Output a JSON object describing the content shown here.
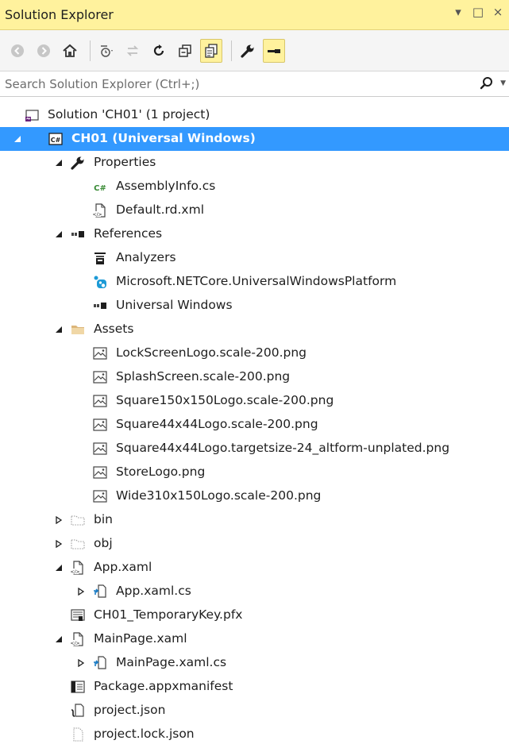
{
  "window": {
    "title": "Solution Explorer",
    "controls": [
      "▾",
      "□",
      "×"
    ]
  },
  "toolbar": {
    "buttons": [
      {
        "name": "back-button",
        "icon": "back-arrow-icon"
      },
      {
        "name": "forward-button",
        "icon": "forward-arrow-icon"
      },
      {
        "name": "home-button",
        "icon": "home-icon"
      },
      {
        "name": "pending-changes-filter-button",
        "icon": "clock-filter-icon"
      },
      {
        "name": "sync-with-active-document-button",
        "icon": "sync-icon"
      },
      {
        "name": "refresh-button",
        "icon": "refresh-icon"
      },
      {
        "name": "collapse-all-button",
        "icon": "collapse-all-icon"
      },
      {
        "name": "show-all-files-button",
        "icon": "show-all-files-icon"
      },
      {
        "name": "properties-button",
        "icon": "wrench-icon"
      },
      {
        "name": "preview-selected-items-button",
        "icon": "preview-icon"
      }
    ]
  },
  "search": {
    "placeholder": "Search Solution Explorer (Ctrl+;)"
  },
  "tree": [
    {
      "label": "Solution 'CH01' (1 project)",
      "icon": "solution-icon",
      "level": 0,
      "expander": "none"
    },
    {
      "label": "CH01 (Universal Windows)",
      "icon": "csharp-project-icon",
      "level": 0,
      "expander": "expanded",
      "selected": true
    },
    {
      "label": "Properties",
      "icon": "wrench-icon",
      "level": 1,
      "expander": "expanded"
    },
    {
      "label": "AssemblyInfo.cs",
      "icon": "csharp-file-icon",
      "level": 2,
      "expander": "none"
    },
    {
      "label": "Default.rd.xml",
      "icon": "xml-file-icon",
      "level": 2,
      "expander": "none"
    },
    {
      "label": "References",
      "icon": "references-icon",
      "level": 1,
      "expander": "expanded"
    },
    {
      "label": "Analyzers",
      "icon": "analyzers-icon",
      "level": 2,
      "expander": "none"
    },
    {
      "label": "Microsoft.NETCore.UniversalWindowsPlatform",
      "icon": "nuget-package-icon",
      "level": 2,
      "expander": "none"
    },
    {
      "label": "Universal Windows",
      "icon": "references-icon",
      "level": 2,
      "expander": "none"
    },
    {
      "label": "Assets",
      "icon": "folder-icon",
      "level": 1,
      "expander": "expanded"
    },
    {
      "label": "LockScreenLogo.scale-200.png",
      "icon": "image-file-icon",
      "level": 2,
      "expander": "none"
    },
    {
      "label": "SplashScreen.scale-200.png",
      "icon": "image-file-icon",
      "level": 2,
      "expander": "none"
    },
    {
      "label": "Square150x150Logo.scale-200.png",
      "icon": "image-file-icon",
      "level": 2,
      "expander": "none"
    },
    {
      "label": "Square44x44Logo.scale-200.png",
      "icon": "image-file-icon",
      "level": 2,
      "expander": "none"
    },
    {
      "label": "Square44x44Logo.targetsize-24_altform-unplated.png",
      "icon": "image-file-icon",
      "level": 2,
      "expander": "none"
    },
    {
      "label": "StoreLogo.png",
      "icon": "image-file-icon",
      "level": 2,
      "expander": "none"
    },
    {
      "label": "Wide310x150Logo.scale-200.png",
      "icon": "image-file-icon",
      "level": 2,
      "expander": "none"
    },
    {
      "label": "bin",
      "icon": "hidden-folder-icon",
      "level": 1,
      "expander": "collapsed"
    },
    {
      "label": "obj",
      "icon": "hidden-folder-icon",
      "level": 1,
      "expander": "collapsed"
    },
    {
      "label": "App.xaml",
      "icon": "xaml-file-icon",
      "level": 1,
      "expander": "expanded"
    },
    {
      "label": "App.xaml.cs",
      "icon": "codebehind-file-icon",
      "level": 2,
      "expander": "collapsed"
    },
    {
      "label": "CH01_TemporaryKey.pfx",
      "icon": "certificate-file-icon",
      "level": 1,
      "expander": "none"
    },
    {
      "label": "MainPage.xaml",
      "icon": "xaml-file-icon",
      "level": 1,
      "expander": "expanded"
    },
    {
      "label": "MainPage.xaml.cs",
      "icon": "codebehind-file-icon",
      "level": 2,
      "expander": "collapsed"
    },
    {
      "label": "Package.appxmanifest",
      "icon": "manifest-file-icon",
      "level": 1,
      "expander": "none"
    },
    {
      "label": "project.json",
      "icon": "json-file-icon",
      "level": 1,
      "expander": "none"
    },
    {
      "label": "project.lock.json",
      "icon": "blank-file-icon",
      "level": 1,
      "expander": "none"
    }
  ],
  "colors": {
    "titlebar_bg": "#fff29d",
    "selection_bg": "#3399ff",
    "accent_purple": "#68217a"
  }
}
